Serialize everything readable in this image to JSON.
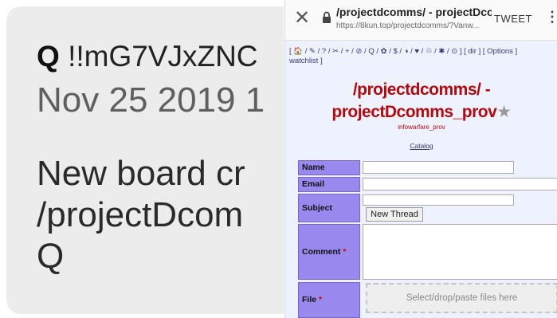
{
  "post": {
    "author_prefix": "Q",
    "tripcode": "!!mG7VJxZNC",
    "date": "Nov 25 2019 1",
    "body_lines": [
      "New board cr",
      "/projectDcom",
      "Q"
    ]
  },
  "browser": {
    "page_title": "/projectdcomms/ - projectDco...",
    "url": "https://8kun.top/projectdcomms/?Vanw...",
    "tweet_label": "TWEET",
    "kebab_glyph": "⋮",
    "close_glyph": "✕"
  },
  "board": {
    "boardlist_line1": "[ 🏠 / ✎ / ? / ✂ / + / ⊘ / Q / ✿ / $ / ◑ / ♥ / ♲ / ✱ / ⊙ ] [ dir ] [ Options ]",
    "boardlist_line2": "watchlist ]",
    "title_line1": "/projectdcomms/ -",
    "title_line2": "projectDcomms_prov",
    "star_glyph": "★",
    "subtitle": "infowarfare_prov",
    "catalog_link": "Catalog"
  },
  "form": {
    "name_label": "Name",
    "email_label": "Email",
    "subject_label": "Subject",
    "comment_label": "Comment",
    "file_label": "File",
    "required_marker": "*",
    "new_thread_button": "New Thread",
    "dropzone_text": "Select/drop/paste files here",
    "name_value": "",
    "email_value": "",
    "subject_value": "",
    "comment_value": ""
  },
  "colors": {
    "board_title": "#af0a0f",
    "label_bg": "#9988ee",
    "page_bg": "#eef2ff"
  }
}
